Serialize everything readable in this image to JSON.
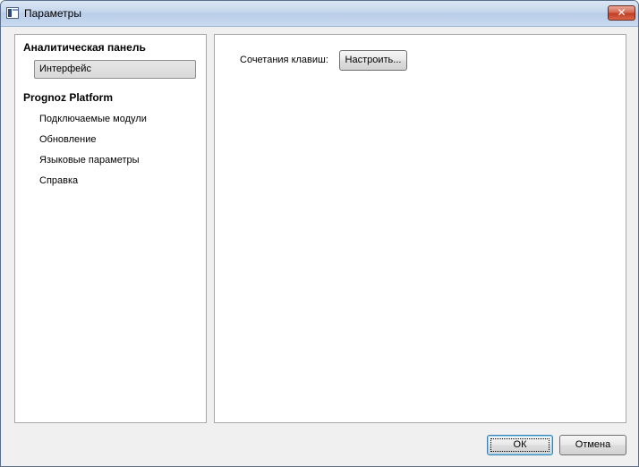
{
  "window": {
    "title": "Параметры",
    "close_label": "✕"
  },
  "nav": {
    "sections": [
      {
        "heading": "Аналитическая панель",
        "items": [
          {
            "label": "Интерфейс",
            "selected": true
          }
        ]
      },
      {
        "heading": "Prognoz Platform",
        "items": [
          {
            "label": "Подключаемые модули",
            "selected": false
          },
          {
            "label": "Обновление",
            "selected": false
          },
          {
            "label": "Языковые параметры",
            "selected": false
          },
          {
            "label": "Справка",
            "selected": false
          }
        ]
      }
    ]
  },
  "content": {
    "shortcuts_label": "Сочетания клавиш:",
    "configure_button": "Настроить..."
  },
  "footer": {
    "ok_label": "ОК",
    "cancel_label": "Отмена"
  }
}
